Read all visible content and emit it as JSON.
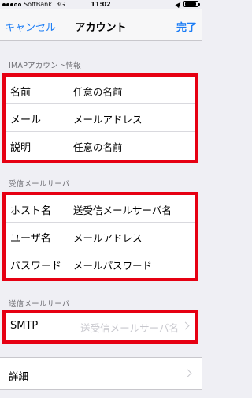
{
  "status_bar": {
    "carrier": "SoftBank",
    "network": "3G",
    "time": "11:02"
  },
  "nav": {
    "cancel_label": "キャンセル",
    "title": "アカウント",
    "done_label": "完了"
  },
  "imap_section": {
    "header": "IMAPアカウント情報",
    "rows": [
      {
        "label": "名前",
        "value": "任意の名前"
      },
      {
        "label": "メール",
        "value": "メールアドレス"
      },
      {
        "label": "説明",
        "value": "任意の名前"
      }
    ]
  },
  "incoming_section": {
    "header": "受信メールサーバ",
    "rows": [
      {
        "label": "ホスト名",
        "value": "送受信メールサーバ名"
      },
      {
        "label": "ユーザ名",
        "value": "メールアドレス"
      },
      {
        "label": "パスワード",
        "value": "メールパスワード"
      }
    ]
  },
  "outgoing_section": {
    "header": "送信メールサーバ",
    "smtp_label": "SMTP",
    "smtp_value": "送受信メールサーバ名"
  },
  "advanced": {
    "label": "詳細"
  },
  "colors": {
    "accent": "#1a7cf5",
    "highlight_border": "#e60012",
    "background": "#efeff4"
  }
}
